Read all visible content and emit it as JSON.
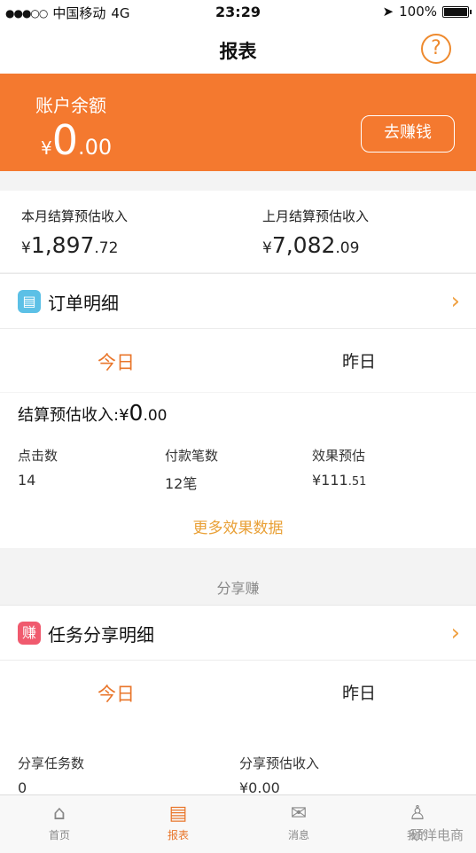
{
  "status_bar": {
    "signal": "●●●○○",
    "carrier": "中国移动",
    "network": "4G",
    "time": "23:29",
    "battery_pct": "100%"
  },
  "nav": {
    "title": "报表",
    "help_icon": "?"
  },
  "balance": {
    "label": "账户余额",
    "yen": "¥",
    "int": "0",
    "dec": ".00",
    "earn_button": "去赚钱"
  },
  "monthly": {
    "this_month": {
      "label": "本月结算预估收入",
      "yen": "¥",
      "int": "1,897",
      "dec": ".72"
    },
    "last_month": {
      "label": "上月结算预估收入",
      "yen": "¥",
      "int": "7,082",
      "dec": ".09"
    }
  },
  "order": {
    "title": "订单明细",
    "tabs": [
      "今日",
      "昨日"
    ],
    "settle_label": "结算预估收入:",
    "settle_yen": "¥",
    "settle_int": "0",
    "settle_dec": ".00",
    "stats": [
      {
        "label": "点击数",
        "value": "14"
      },
      {
        "label": "付款笔数",
        "value": "12笔"
      },
      {
        "label": "效果预估",
        "value": "¥111",
        "value_dec": ".51"
      }
    ],
    "more": "更多效果数据"
  },
  "share": {
    "section_label": "分享赚",
    "title": "任务分享明细",
    "tabs": [
      "今日",
      "昨日"
    ],
    "stats": [
      {
        "label": "分享任务数",
        "value": "0"
      },
      {
        "label": "分享预估收入",
        "value": "¥0.00"
      }
    ]
  },
  "tabbar": {
    "items": [
      {
        "label": "首页",
        "icon": "⌂"
      },
      {
        "label": "报表",
        "icon": "▤"
      },
      {
        "label": "消息",
        "icon": "✉"
      },
      {
        "label": "我的",
        "icon": "♙"
      }
    ],
    "watermark": "硕洋电商"
  },
  "colors": {
    "accent": "#f4792f",
    "text": "#222222",
    "bg": "#f3f3f3"
  }
}
